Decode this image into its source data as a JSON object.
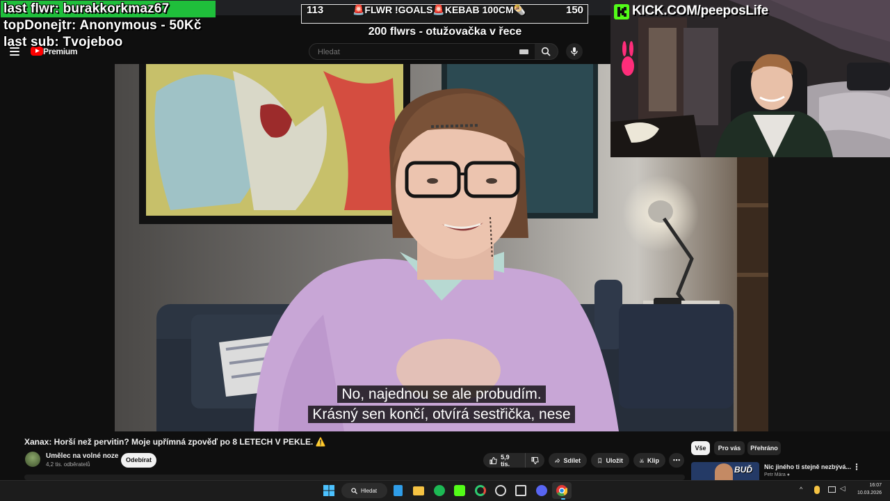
{
  "overlay": {
    "last_follower": "last flwr: burakkorkmaz67",
    "top_donor": "topDonejtr: Anonymous - 50Kč",
    "last_sub": "last sub: Tvojeboo"
  },
  "goal_bar": {
    "current": "113",
    "goal": "150",
    "progress": 0.753,
    "label": "🚨FLWR !GOALS🚨KEBAB 100CM🌯",
    "subtitle": "200 flwrs - otužovačka v řece",
    "fill_color": "#1fbf3b"
  },
  "webcam": {
    "channel": "KICK.COM/peeposLife",
    "brand_color": "#53fc18"
  },
  "youtube": {
    "logo_text": "Premium",
    "search_placeholder": "Hledat",
    "icons": [
      "menu-icon",
      "youtube-logo-icon",
      "keyboard-icon",
      "search-icon",
      "mic-icon"
    ]
  },
  "subtitles": {
    "line1": "No, najednou se ale probudím.",
    "line2": "Krásný sen končí, otvírá sestřička, nese"
  },
  "video": {
    "title": "Xanax: Horší než pervitin? Moje upřímná zpověď po 8 LETECH V PEKLE. ⚠️",
    "channel": "Umělec na volné noze",
    "subscribers": "4,2 tis. odběratelů",
    "subscribe_label": "Odebírat",
    "likes": "5,9 tis.",
    "share_label": "Sdílet",
    "save_label": "Uložit",
    "clip_label": "Klip",
    "more_label": "⋯"
  },
  "side_panel": {
    "chips": [
      "Vše",
      "Pro vás",
      "Přehráno"
    ],
    "rec_thumb_text": "BUĎ",
    "rec_title": "Nic jiného ti stejně nezbývá...",
    "rec_channel": "Petr Mára"
  },
  "taskbar": {
    "search_label": "Hledat",
    "time": "16:07",
    "date": "10.03.2026"
  }
}
